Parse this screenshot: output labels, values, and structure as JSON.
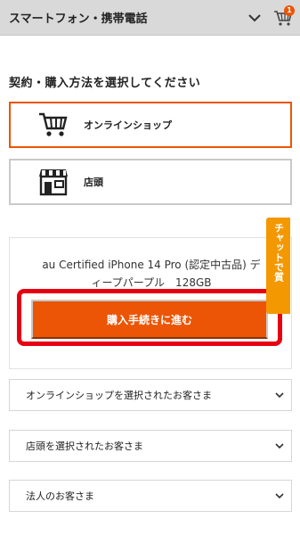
{
  "header": {
    "title": "スマートフォン・携帯電話",
    "cart_count": "1"
  },
  "section": {
    "title": "契約・購入方法を選択してください"
  },
  "options": [
    {
      "label": "オンラインショップ",
      "icon": "cart-icon",
      "selected": true
    },
    {
      "label": "店頭",
      "icon": "store-icon",
      "selected": false
    }
  ],
  "product": {
    "name_line1": "au Certified iPhone 14 Pro (認定中古品) デ",
    "name_line2": "ィープパープル　128GB",
    "buy_button": "購入手続きに進む"
  },
  "chat_tab": {
    "label": "チャットで質"
  },
  "accordions": [
    {
      "label": "オンラインショップを選択されたお客さま"
    },
    {
      "label": "店頭を選択されたお客さま"
    },
    {
      "label": "法人のお客さま"
    }
  ],
  "colors": {
    "accent": "#eb5505",
    "highlight": "#e60012",
    "chat": "#f39800",
    "header_bg": "#d9d9d9"
  }
}
